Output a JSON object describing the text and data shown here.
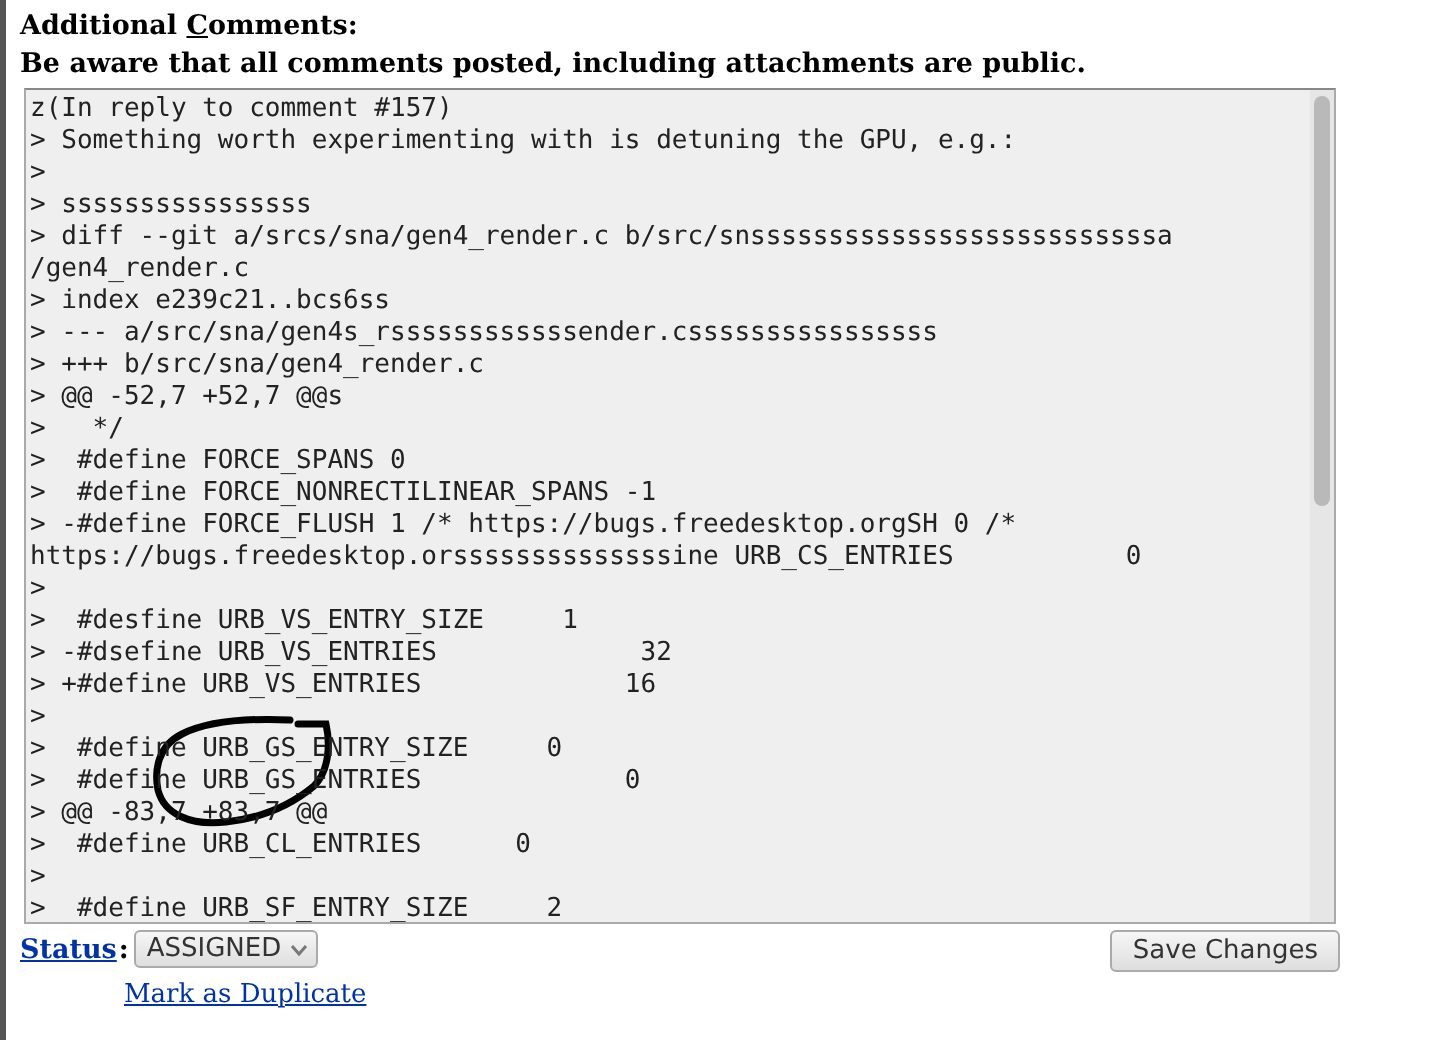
{
  "heading": {
    "parts": [
      {
        "text": "Additional ",
        "underlined": false
      },
      {
        "text": "C",
        "underlined": true
      },
      {
        "text": "omments:",
        "underlined": false
      }
    ]
  },
  "notice": "Be aware that all comments posted, including attachments are public.",
  "comment": {
    "lines": [
      "z(In reply to comment #157)",
      "> Something worth experimenting with is detuning the GPU, e.g.:",
      ">",
      "> ssssssssssssssss",
      "> diff --git a/srcs/sna/gen4_render.c b/src/snssssssssssssssssssssssssssa",
      "/gen4_render.c",
      "> index e239c21..bcs6ss",
      "> --- a/src/sna/gen4s_rssssssssssssender.cssssssssssssssss",
      "> +++ b/src/sna/gen4_render.c",
      "> @@ -52,7 +52,7 @@s",
      ">   */",
      ">  #define FORCE_SPANS 0",
      ">  #define FORCE_NONRECTILINEAR_SPANS -1",
      "> -#define FORCE_FLUSH 1 /* https://bugs.freedesktop.orgSH 0 /*",
      "https://bugs.freedesktop.orssssssssssssssine URB_CS_ENTRIES           0",
      ">",
      ">  #desfine URB_VS_ENTRY_SIZE     1",
      "> -#dsefine URB_VS_ENTRIES             32",
      "> +#define URB_VS_ENTRIES             16",
      ">",
      ">  #define URB_GS_ENTRY_SIZE     0",
      ">  #define URB_GS_ENTRIES             0",
      "> @@ -83,7 +83,7 @@",
      ">  #define URB_CL_ENTRIES      0",
      ">",
      ">  #define URB_SF_ENTRY_SIZE     2"
    ]
  },
  "status": {
    "label": "Status",
    "separator": ":",
    "value": "ASSIGNED"
  },
  "duplicate_link": "Mark as Duplicate",
  "save_button": "Save Changes"
}
